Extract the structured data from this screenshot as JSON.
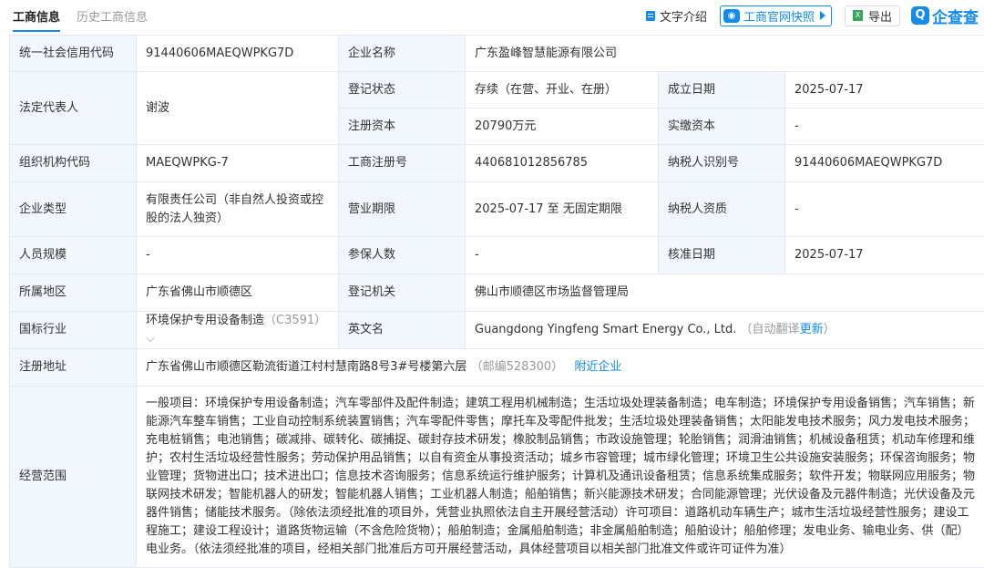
{
  "tabs": [
    "工商信息",
    "历史工商信息"
  ],
  "tools": {
    "intro": "文字介绍",
    "snapshot": "工商官网快照",
    "export": "导出",
    "brand": "企查查"
  },
  "labels": {
    "credit_code": "统一社会信用代码",
    "company_name": "企业名称",
    "legal_rep": "法定代表人",
    "reg_status": "登记状态",
    "est_date": "成立日期",
    "reg_capital": "注册资本",
    "paid_capital": "实缴资本",
    "org_code": "组织机构代码",
    "reg_no": "工商注册号",
    "taxpayer_id": "纳税人识别号",
    "company_type": "企业类型",
    "biz_term": "营业期限",
    "taxpayer_qual": "纳税人资质",
    "staff_size": "人员规模",
    "insured": "参保人数",
    "approval_date": "核准日期",
    "region": "所属地区",
    "reg_authority": "登记机关",
    "industry": "国标行业",
    "english_name": "英文名",
    "address": "注册地址",
    "scope": "经营范围"
  },
  "values": {
    "credit_code": "91440606MAEQWPKG7D",
    "company_name": "广东盈峰智慧能源有限公司",
    "legal_rep": "谢波",
    "reg_status": "存续（在营、开业、在册）",
    "est_date": "2025-07-17",
    "reg_capital": "20790万元",
    "paid_capital": "-",
    "org_code": "MAEQWPKG-7",
    "reg_no": "440681012856785",
    "taxpayer_id": "91440606MAEQWPKG7D",
    "company_type": "有限责任公司（非自然人投资或控股的法人独资）",
    "biz_term": "2025-07-17 至 无固定期限",
    "taxpayer_qual": "-",
    "staff_size": "-",
    "insured": "-",
    "approval_date": "2025-07-17",
    "region": "广东省佛山市顺德区",
    "reg_authority": "佛山市顺德区市场监督管理局",
    "industry": "环境保护专用设备制造",
    "industry_code": "（C3591）",
    "english_name": "Guangdong Yingfeng Smart Energy Co., Ltd.",
    "auto_translate": "（自动翻译",
    "translate_update": "更新",
    "translate_close": "）",
    "address": "广东省佛山市顺德区勒流街道江村村慧南路8号3#号楼第六层",
    "postcode": "（邮编528300）",
    "nearby": "附近企业",
    "scope": "一般项目：环境保护专用设备制造；汽车零部件及配件制造；建筑工程用机械制造；生活垃圾处理装备制造；电车制造；环境保护专用设备销售；汽车销售；新能源汽车整车销售；工业自动控制系统装置销售；汽车零配件零售；摩托车及零配件批发；生活垃圾处理装备销售；太阳能发电技术服务；风力发电技术服务；充电桩销售；电池销售；碳减排、碳转化、碳捕捉、碳封存技术研发；橡胶制品销售；市政设施管理；轮胎销售；润滑油销售；机械设备租赁；机动车修理和维护；农村生活垃圾经营性服务；劳动保护用品销售；以自有资金从事投资活动；城乡市容管理；城市绿化管理；环境卫生公共设施安装服务；环保咨询服务；物业管理；货物进出口；技术进出口；信息技术咨询服务；信息系统运行维护服务；计算机及通讯设备租赁；信息系统集成服务；软件开发；物联网应用服务；物联网技术研发；智能机器人的研发；智能机器人销售；工业机器人制造；船舶销售；新兴能源技术研发；合同能源管理；光伏设备及元器件制造；光伏设备及元器件销售；储能技术服务。（除依法须经批准的项目外，凭营业执照依法自主开展经营活动）许可项目：道路机动车辆生产；城市生活垃圾经营性服务；建设工程施工；建设工程设计；道路货物运输（不含危险货物）；船舶制造；金属船舶制造；非金属船舶制造；船舶设计；船舶修理；发电业务、输电业务、供（配）电业务。（依法须经批准的项目，经相关部门批准后方可开展经营活动，具体经营项目以相关部门批准文件或许可证件为准）"
  },
  "colors": {
    "accent": "#128bed",
    "label_bg": "#f2f7fd",
    "border": "#e4e8ef"
  }
}
